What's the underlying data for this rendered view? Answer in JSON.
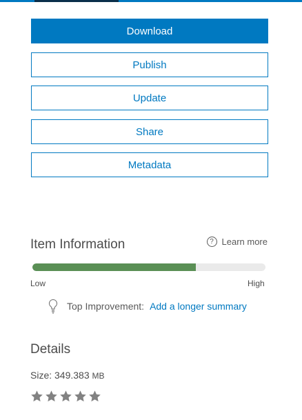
{
  "actions": {
    "download_label": "Download",
    "publish_label": "Publish",
    "update_label": "Update",
    "share_label": "Share",
    "metadata_label": "Metadata"
  },
  "item_information": {
    "title": "Item Information",
    "learn_more": "Learn more",
    "score_fraction": 0.7,
    "low_label": "Low",
    "high_label": "High",
    "top_improvement_label": "Top Improvement:",
    "top_improvement_link": "Add a longer summary"
  },
  "details": {
    "title": "Details",
    "size_label": "Size:",
    "size_value": "349.383",
    "size_unit": "MB",
    "rating": 0,
    "rating_max": 5
  },
  "colors": {
    "accent": "#0079c1",
    "progress": "#5a8f55",
    "star_empty": "#828282"
  },
  "icons": {
    "learn_more": "question-circle-icon",
    "improvement": "lightbulb-icon",
    "rating": "star-icon"
  }
}
